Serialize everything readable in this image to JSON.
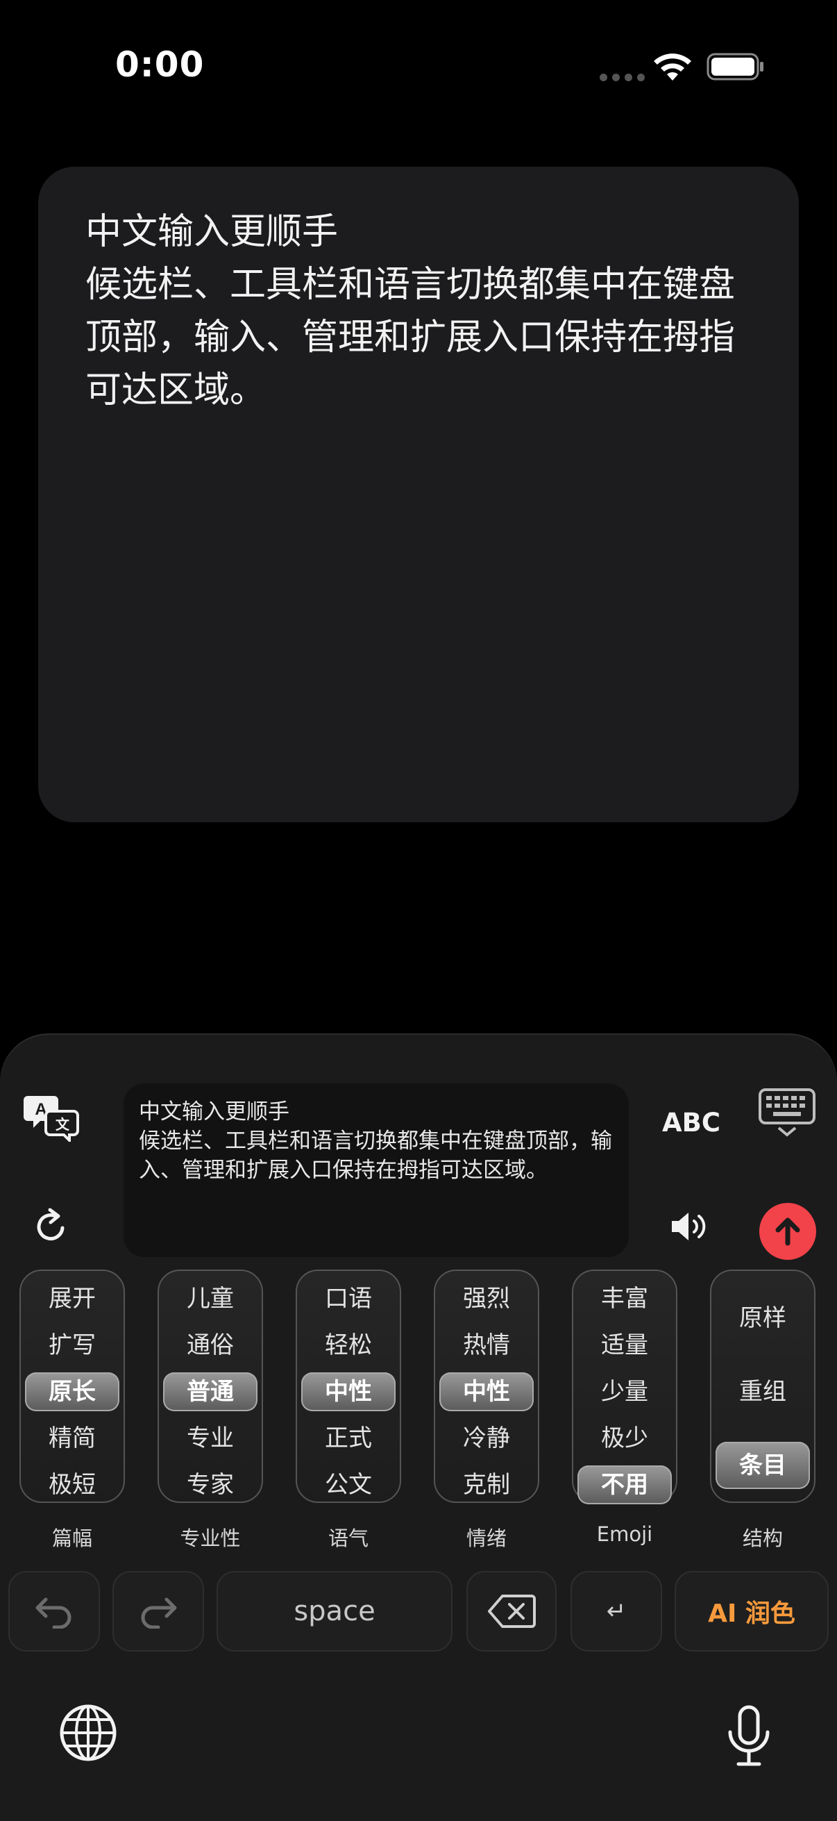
{
  "status_bar": {
    "time": "0:00"
  },
  "note": {
    "text": "中文输入更顺手\n候选栏、工具栏和语言切换都集中在键盘顶部，输入、管理和扩展入口保持在拇指可达区域。"
  },
  "keyboard": {
    "preview_text": "中文输入更顺手\n候选栏、工具栏和语言切换都集中在键盘顶部，输入、管理和扩展入口保持在拇指可达区域。",
    "abc_label": "ABC",
    "pickers": [
      {
        "label": "篇幅",
        "options": [
          "展开",
          "扩写",
          "原长",
          "精简",
          "极短"
        ],
        "selected": "原长"
      },
      {
        "label": "专业性",
        "options": [
          "儿童",
          "通俗",
          "普通",
          "专业",
          "专家"
        ],
        "selected": "普通"
      },
      {
        "label": "语气",
        "options": [
          "口语",
          "轻松",
          "中性",
          "正式",
          "公文"
        ],
        "selected": "中性"
      },
      {
        "label": "情绪",
        "options": [
          "强烈",
          "热情",
          "中性",
          "冷静",
          "克制"
        ],
        "selected": "中性"
      },
      {
        "label": "Emoji",
        "options": [
          "丰富",
          "适量",
          "少量",
          "极少",
          "不用"
        ],
        "selected": "不用"
      },
      {
        "label": "结构",
        "options": [
          "原样",
          "重组",
          "条目"
        ],
        "selected": "条目"
      }
    ],
    "space_label": "space",
    "return_label": "↵",
    "ai_polish_label": "AI 润色"
  },
  "colors": {
    "send": "#f2424a",
    "ai_accent": "#f79a3c"
  },
  "icons": [
    "wifi-icon",
    "battery-icon",
    "translate-icon",
    "keyboard-hide-icon",
    "refresh-icon",
    "speaker-icon",
    "arrow-up-icon",
    "undo-icon",
    "redo-icon",
    "backspace-icon",
    "globe-icon",
    "microphone-icon"
  ]
}
